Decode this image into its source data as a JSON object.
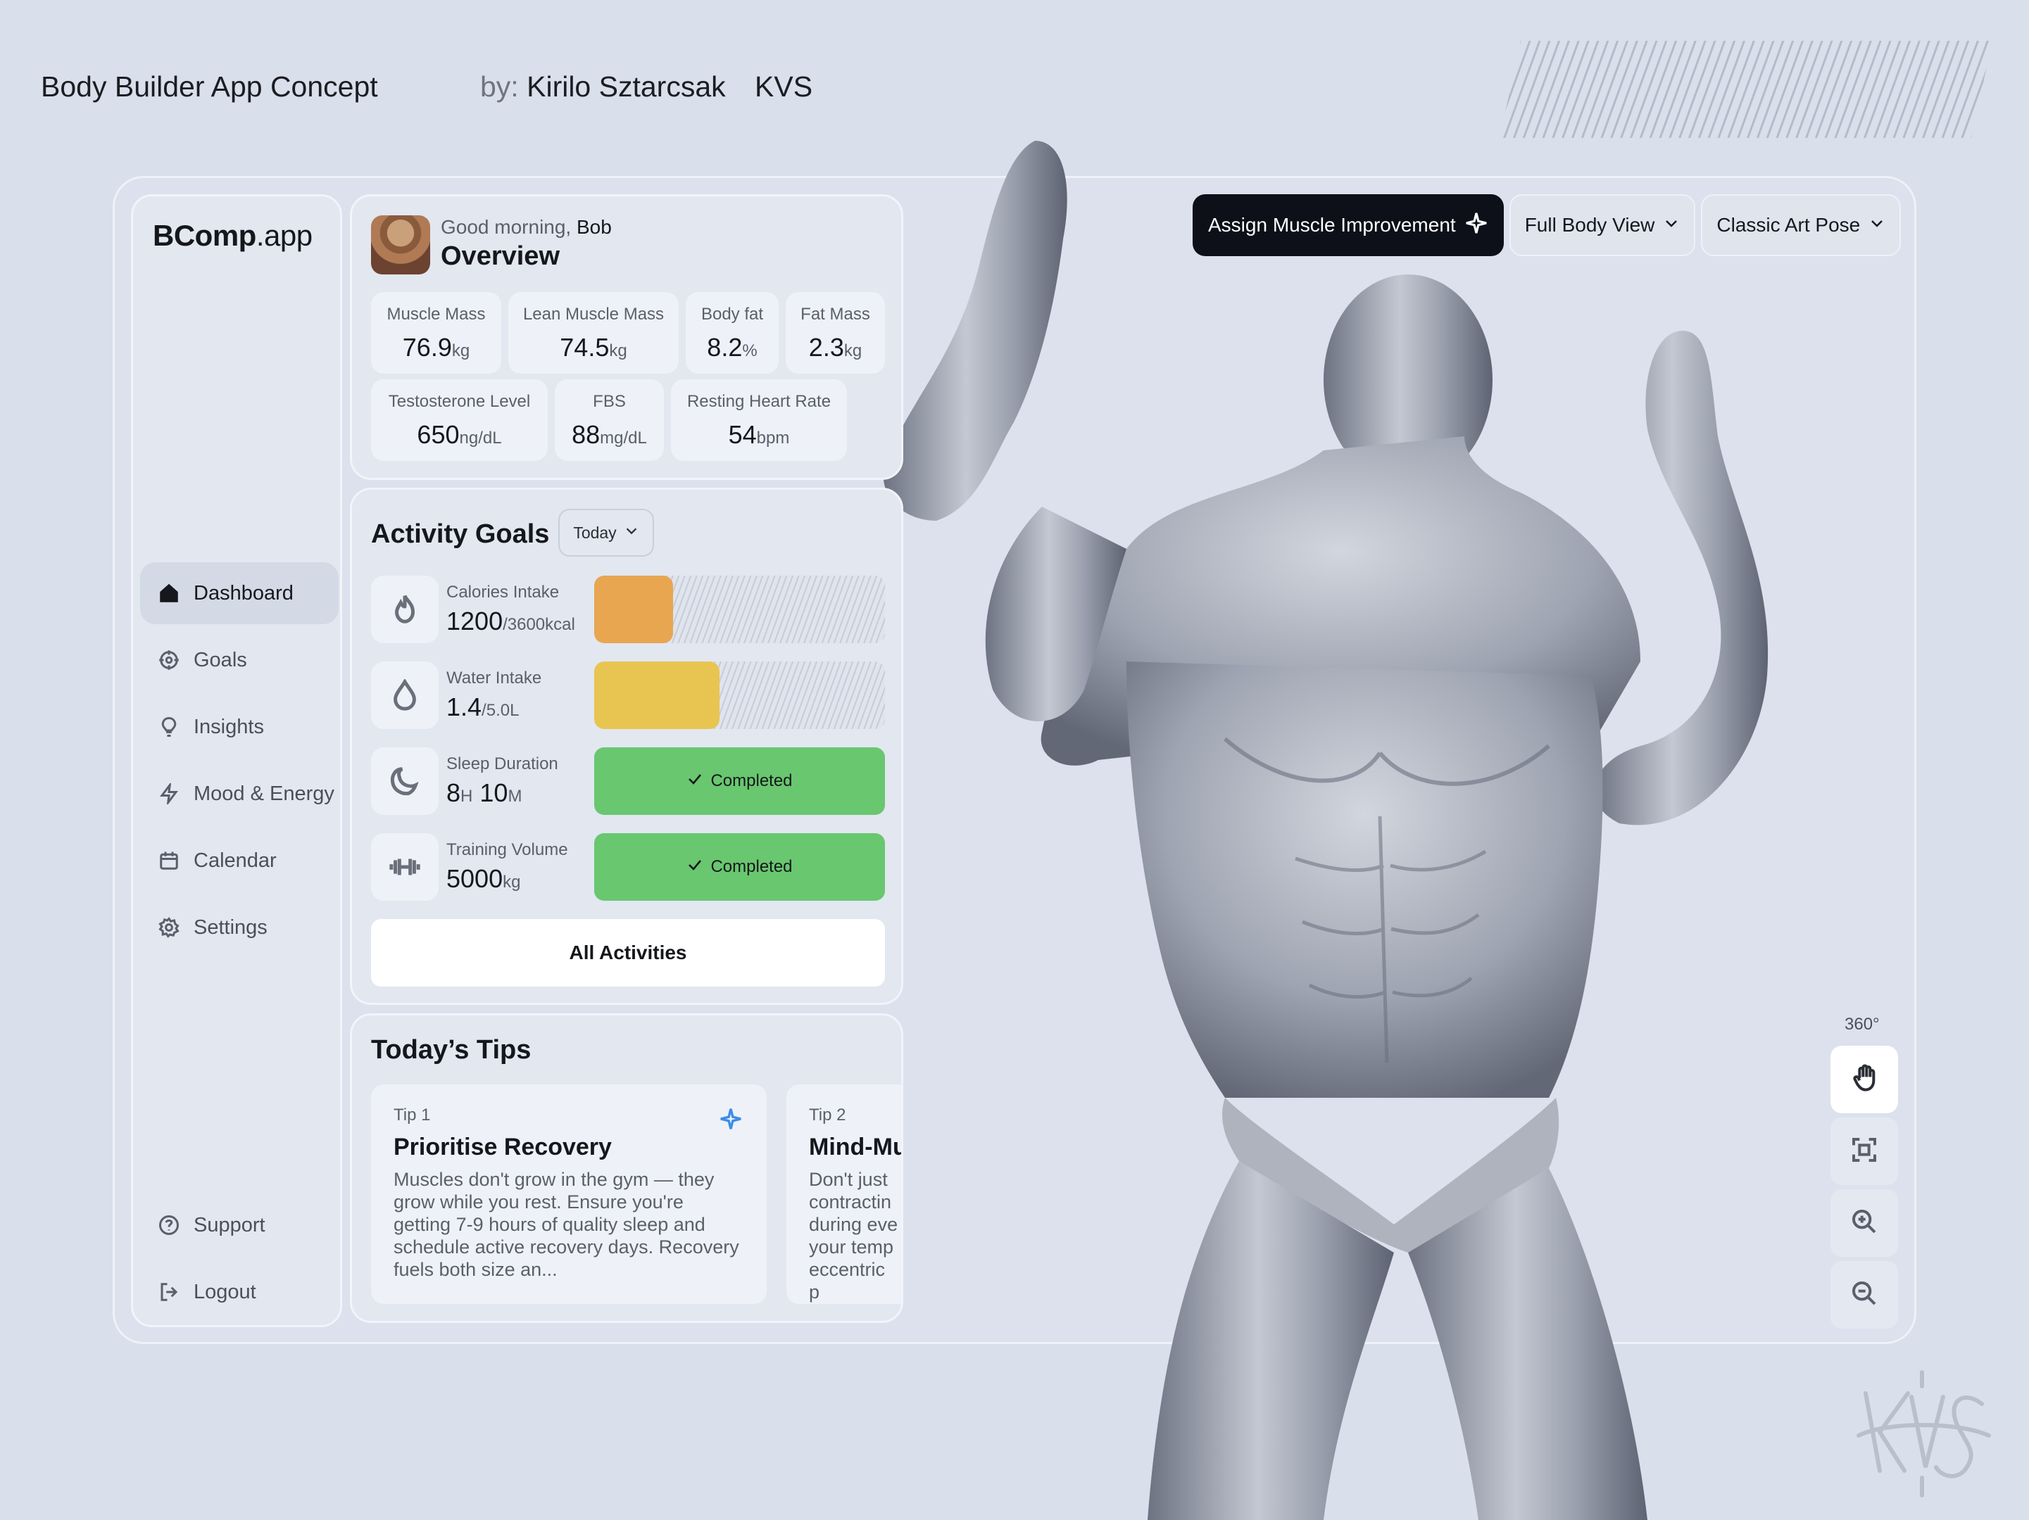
{
  "credits": {
    "title": "Body Builder App Concept",
    "by_prefix": "by:",
    "author": "Kirilo Sztarcsak",
    "studio": "KVS"
  },
  "app": {
    "logo_bold": "BComp",
    "logo_light": ".app"
  },
  "sidebar": {
    "items": [
      {
        "label": "Dashboard",
        "icon": "home-icon",
        "active": true
      },
      {
        "label": "Goals",
        "icon": "target-icon"
      },
      {
        "label": "Insights",
        "icon": "lightbulb-icon"
      },
      {
        "label": "Mood & Energy",
        "icon": "lightning-icon"
      },
      {
        "label": "Calendar",
        "icon": "calendar-icon"
      },
      {
        "label": "Settings",
        "icon": "gear-icon"
      }
    ],
    "bottom": [
      {
        "label": "Support",
        "icon": "help-circle-icon"
      },
      {
        "label": "Logout",
        "icon": "logout-icon"
      }
    ]
  },
  "overview": {
    "greeting": "Good morning,",
    "user": "Bob",
    "title": "Overview",
    "stats": [
      {
        "label": "Muscle Mass",
        "value": "76.9",
        "unit": "kg"
      },
      {
        "label": "Lean Muscle Mass",
        "value": "74.5",
        "unit": "kg"
      },
      {
        "label": "Body fat",
        "value": "8.2",
        "unit": "%"
      },
      {
        "label": "Fat Mass",
        "value": "2.3",
        "unit": "kg"
      },
      {
        "label": "Testosterone Level",
        "value": "650",
        "unit": "ng/dL"
      },
      {
        "label": "FBS",
        "value": "88",
        "unit": "mg/dL"
      },
      {
        "label": "Resting Heart Rate",
        "value": "54",
        "unit": "bpm"
      }
    ]
  },
  "activity": {
    "title": "Activity Goals",
    "period": "Today",
    "rows": [
      {
        "label": "Calories Intake",
        "value": "1200",
        "unit": "/3600kcal",
        "progress": 0.27,
        "color": "#e8a650",
        "icon": "flame-icon"
      },
      {
        "label": "Water Intake",
        "value": "1.4",
        "unit": "/5.0L",
        "progress": 0.43,
        "color": "#e8c550",
        "icon": "droplet-icon"
      },
      {
        "label": "Sleep Duration",
        "value_a": "8",
        "unit_a": "H",
        "value_b": "10",
        "unit_b": "M",
        "status": "Completed",
        "icon": "moon-icon"
      },
      {
        "label": "Training Volume",
        "value": "5000",
        "unit": "kg",
        "status": "Completed",
        "icon": "dumbbell-icon"
      }
    ],
    "all_button": "All Activities"
  },
  "tips": {
    "title": "Today’s Tips",
    "items": [
      {
        "number": "Tip 1",
        "title": "Prioritise Recovery",
        "body": "Muscles don't grow in the gym — they grow while you rest. Ensure you're getting 7-9 hours of quality sleep and schedule active recovery days. Recovery fuels both size an..."
      },
      {
        "number": "Tip 2",
        "title": "Mind-Mu",
        "body": "Don't just contractin during eve your temp eccentric p"
      }
    ]
  },
  "controls": {
    "assign": "Assign Muscle Improvement",
    "view": "Full Body View",
    "pose": "Classic Art Pose",
    "rotation_label": "360°"
  },
  "colors": {
    "background": "#d9dfeb",
    "calories": "#e8a650",
    "water": "#e8c550",
    "completed": "#69c76f",
    "primary_button": "#0d1019",
    "accent": "#3b8de8"
  }
}
